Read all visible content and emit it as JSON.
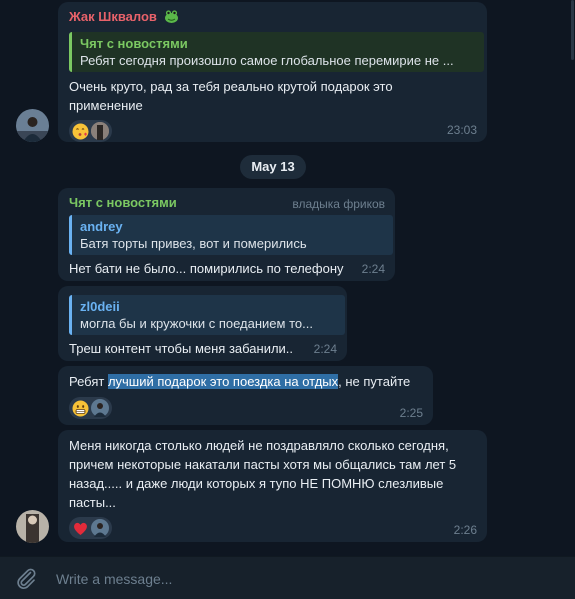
{
  "messages": [
    {
      "sender": "Жак Шквалов",
      "sender_color": "#e8626a",
      "reply_name": "Чят с новостями",
      "reply_text": "Ребят сегодня произошло самое глобальное перемирие не ...",
      "text_line1": "Очень круто, рад за тебя реально крутой подарок это",
      "text_line2": "применение",
      "time": "23:03"
    },
    {
      "sender": "Чят с новостями",
      "sender_color": "#7bc862",
      "role": "владыка фриков",
      "reply_name": "andrey",
      "reply_text": "Батя торты привез, вот и померились",
      "text": "Нет бати не было... помирились по телефону",
      "time": "2:24"
    },
    {
      "reply_name": "zl0deii",
      "reply_text": "могла бы и кружочки с поеданием то...",
      "text": "Треш контент чтобы меня забанили..",
      "time": "2:24"
    },
    {
      "text_before": "Ребят ",
      "text_highlight": "лучший подарок это поездка на отдых",
      "text_after": ", не путайте",
      "time": "2:25"
    },
    {
      "text_line1": "Меня никогда столько людей не поздравляло сколько сегодня,",
      "text_line2": "причем некоторые накатали пасты хотя мы общались там лет 5",
      "text_line3": "назад..... и даже люди которых я тупо НЕ ПОМНЮ слезливые",
      "text_line4": "пасты...",
      "time": "2:26"
    }
  ],
  "date_separator": "May 13",
  "composer": {
    "placeholder": "Write a message..."
  },
  "icons": {
    "attach": "paperclip-icon",
    "sender_badge": "frog-emoji-icon",
    "reactions": [
      "kiss-face-emoji",
      "grin-face-emoji",
      "red-heart-emoji"
    ]
  },
  "colors": {
    "background": "#0e1621",
    "bubble": "#182533",
    "accent_blue": "#6ab2f2",
    "selection": "#2f6ea5"
  }
}
